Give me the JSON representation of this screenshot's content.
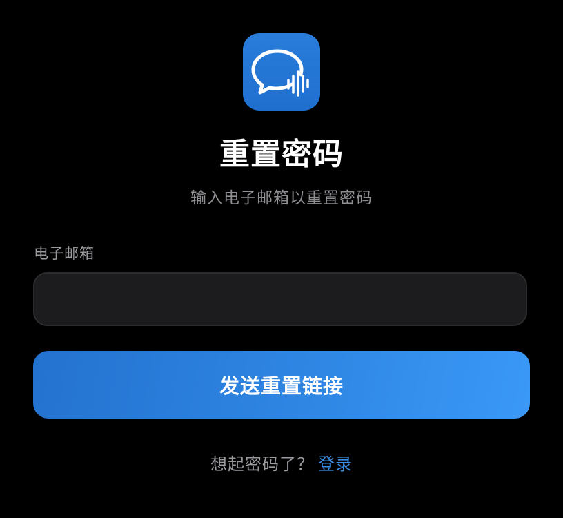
{
  "app_icon": {
    "icon": "chat-bubble-soundwave-icon",
    "color": "#1f72d3"
  },
  "header": {
    "title": "重置密码",
    "subtitle": "输入电子邮箱以重置密码"
  },
  "form": {
    "email_label": "电子邮箱",
    "email_value": "",
    "submit_label": "发送重置链接",
    "accent_color": "#3a98f7"
  },
  "footer": {
    "prompt": "想起密码了？",
    "login_label": "登录"
  }
}
